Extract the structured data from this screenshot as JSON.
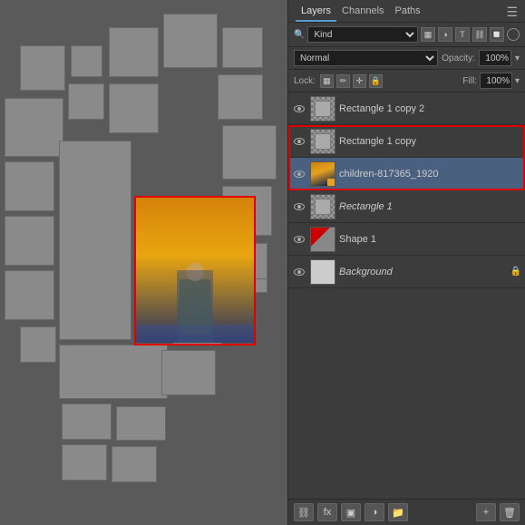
{
  "panel": {
    "title": "Layers",
    "tabs": [
      "Layers",
      "Channels",
      "Paths"
    ],
    "active_tab": "Layers",
    "filter_label": "Kind",
    "mode": "Normal",
    "opacity_label": "Opacity:",
    "opacity_value": "100%",
    "lock_label": "Lock:",
    "fill_label": "Fill:",
    "fill_value": "100%"
  },
  "layers": [
    {
      "name": "Rectangle 1 copy 2",
      "type": "rect",
      "visible": true,
      "selected": false,
      "in_selection": false
    },
    {
      "name": "Rectangle 1 copy",
      "type": "rect",
      "visible": true,
      "selected": false,
      "in_selection": false
    },
    {
      "name": "children-817365_1920",
      "type": "photo",
      "visible": true,
      "selected": true,
      "in_selection": true
    },
    {
      "name": "Rectangle 1",
      "type": "rect_white",
      "visible": true,
      "selected": false,
      "in_selection": true
    },
    {
      "name": "Shape 1",
      "type": "shape_red",
      "visible": true,
      "selected": false,
      "in_selection": false
    },
    {
      "name": "Background",
      "type": "bg",
      "visible": true,
      "selected": false,
      "in_selection": false,
      "locked": true
    }
  ],
  "footer_buttons": [
    "link",
    "fx",
    "mask",
    "circle",
    "folder",
    "trash"
  ]
}
